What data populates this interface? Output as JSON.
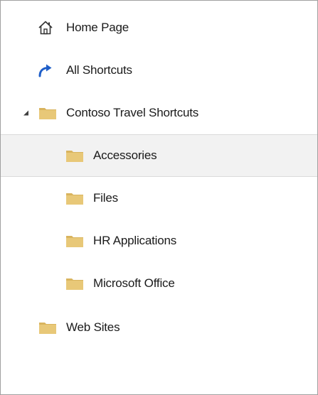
{
  "tree": {
    "home": {
      "label": "Home Page",
      "icon": "home-icon"
    },
    "all_shortcuts": {
      "label": "All Shortcuts",
      "icon": "redo-arrow-icon"
    },
    "contoso": {
      "label": "Contoso Travel Shortcuts",
      "icon": "folder-icon",
      "expanded": true,
      "children": [
        {
          "label": "Accessories",
          "icon": "folder-icon",
          "selected": true
        },
        {
          "label": "Files",
          "icon": "folder-icon"
        },
        {
          "label": "HR Applications",
          "icon": "folder-icon"
        },
        {
          "label": "Microsoft Office",
          "icon": "folder-icon"
        }
      ]
    },
    "web_sites": {
      "label": "Web Sites",
      "icon": "folder-icon"
    }
  },
  "colors": {
    "folder": "#e8c878",
    "folder_tab": "#d9b45e",
    "arrow_blue": "#1e5ec8",
    "selected_bg": "#f2f2f2",
    "text": "#1a1a1a"
  }
}
